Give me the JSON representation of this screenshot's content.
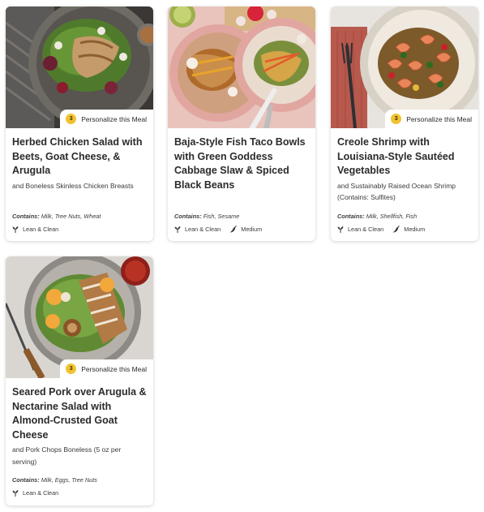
{
  "colors": {
    "badge": "#f2c230",
    "card_shadow": "#d0d0d0"
  },
  "meals": [
    {
      "title": "Herbed Chicken Salad with Beets, Goat Cheese, & Arugula",
      "subtitle": "and Boneless Skinless Chicken Breasts",
      "contains_label": "Contains:",
      "contains_items": "Milk, Tree Nuts, Wheat",
      "personalize_count": "3",
      "personalize_label": "Personalize this Meal",
      "tags": [
        {
          "icon": "leaf-icon",
          "label": "Lean & Clean"
        }
      ]
    },
    {
      "title": "Baja-Style Fish Taco Bowls with Green Goddess Cabbage Slaw & Spiced Black Beans",
      "subtitle": "",
      "contains_label": "Contains:",
      "contains_items": "Fish, Sesame",
      "tags": [
        {
          "icon": "leaf-icon",
          "label": "Lean & Clean"
        },
        {
          "icon": "chili-pepper-icon",
          "label": "Medium"
        }
      ]
    },
    {
      "title": "Creole Shrimp with Louisiana-Style Sautéed Vegetables",
      "subtitle": "and Sustainably Raised Ocean Shrimp (Contains: Sulfites)",
      "contains_label": "Contains:",
      "contains_items": "Milk, Shellfish, Fish",
      "personalize_count": "3",
      "personalize_label": "Personalize this Meal",
      "tags": [
        {
          "icon": "leaf-icon",
          "label": "Lean & Clean"
        },
        {
          "icon": "chili-pepper-icon",
          "label": "Medium"
        }
      ]
    },
    {
      "title": "Seared Pork over Arugula & Nectarine Salad with Almond-Crusted Goat Cheese",
      "subtitle": "and Pork Chops Boneless (5 oz per serving)",
      "contains_label": "Contains:",
      "contains_items": "Milk, Eggs, Tree Nuts",
      "personalize_count": "3",
      "personalize_label": "Personalize this Meal",
      "tags": [
        {
          "icon": "leaf-icon",
          "label": "Lean & Clean"
        }
      ]
    }
  ]
}
